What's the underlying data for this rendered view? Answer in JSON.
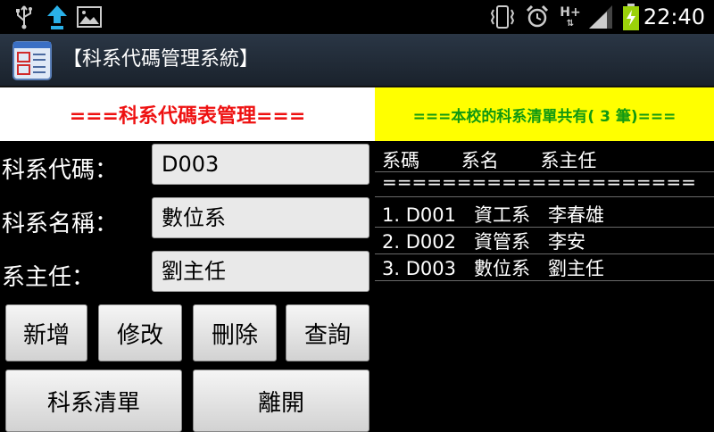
{
  "status_bar": {
    "time": "22:40",
    "icons": [
      "usb-icon",
      "upload-icon",
      "image-icon",
      "vibrate-icon",
      "alarm-icon",
      "hplus-data-icon",
      "signal-icon",
      "battery-charging-icon"
    ],
    "hplus_label": "H+"
  },
  "app": {
    "title": "【科系代碼管理系統】"
  },
  "banner": {
    "left": "===科系代碼表管理===",
    "right": "===本校的科系清單共有( 3 筆)==="
  },
  "form": {
    "dept_code_label": "科系代碼：",
    "dept_code_value": "D003",
    "dept_name_label": "科系名稱：",
    "dept_name_value": "數位系",
    "director_label": "系主任：",
    "director_value": "劉主任"
  },
  "buttons": {
    "add": "新增",
    "edit": "修改",
    "delete": "刪除",
    "query": "查詢",
    "list": "科系清單",
    "exit": "離開"
  },
  "list": {
    "header": "系碼       系名       系主任",
    "separator": "=====================",
    "rows": [
      "1. D001   資工系   李春雄",
      "2. D002   資管系   李安",
      "3. D003   數位系   劉主任"
    ]
  }
}
